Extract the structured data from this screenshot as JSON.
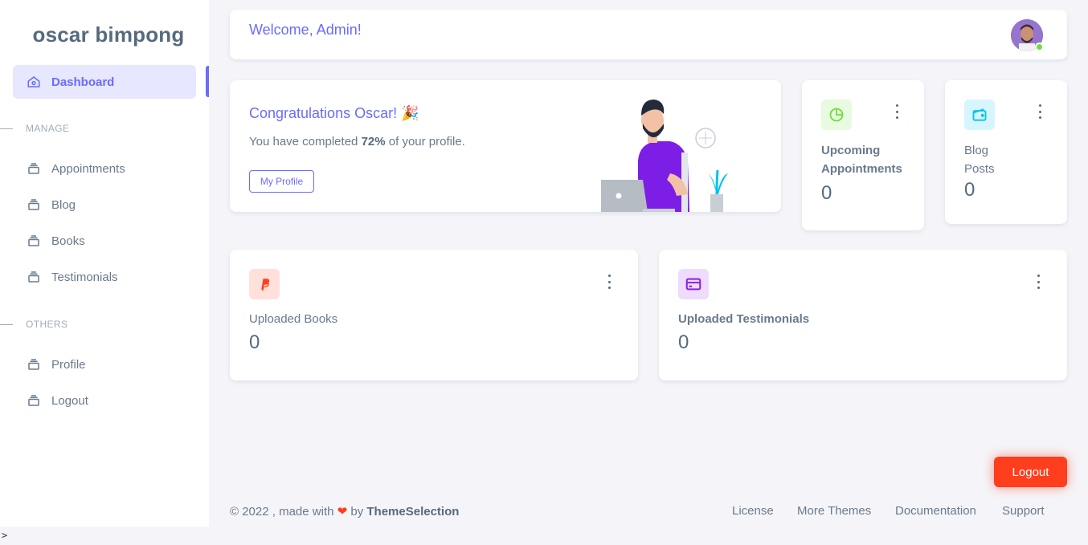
{
  "sidebar": {
    "brand": "oscar bimpong",
    "items": {
      "dashboard": "Dashboard",
      "appointments": "Appointments",
      "blog": "Blog",
      "books": "Books",
      "testimonials": "Testimonials",
      "profile": "Profile",
      "logout": "Logout"
    },
    "headers": {
      "manage": "MANAGE",
      "others": "OTHERS"
    }
  },
  "navbar": {
    "welcome": "Welcome, Admin!",
    "avatar_icon": "user-avatar",
    "status_color": "#71dd37"
  },
  "congrats": {
    "title": "Congratulations Oscar! 🎉",
    "text_before": "You have completed ",
    "percent": "72%",
    "text_after": " of your profile.",
    "button": "My Profile"
  },
  "stats": {
    "appointments": {
      "label_line1": "Upcoming",
      "label_line2": "Appointments",
      "value": "0",
      "icon": "pie-chart-icon",
      "color": "#71dd37"
    },
    "blog": {
      "label_line1": "Blog",
      "label_line2": "Posts",
      "value": "0",
      "icon": "wallet-icon",
      "color": "#03c3ec"
    },
    "books": {
      "label": "Uploaded Books",
      "value": "0",
      "icon": "paypal-icon",
      "color": "#ff3e1d"
    },
    "testimonials": {
      "label": "Uploaded Testimonials",
      "value": "0",
      "icon": "credit-card-icon",
      "color": "#8d1ee6"
    }
  },
  "logout_button": "Logout",
  "footer": {
    "copyright": "© 2022 , made with ",
    "by": " by ",
    "brand": "ThemeSelection",
    "links": {
      "license": "License",
      "more_themes": "More Themes",
      "documentation": "Documentation",
      "support": "Support"
    }
  },
  "colors": {
    "primary": "#696cff",
    "danger": "#ff3e1d"
  }
}
